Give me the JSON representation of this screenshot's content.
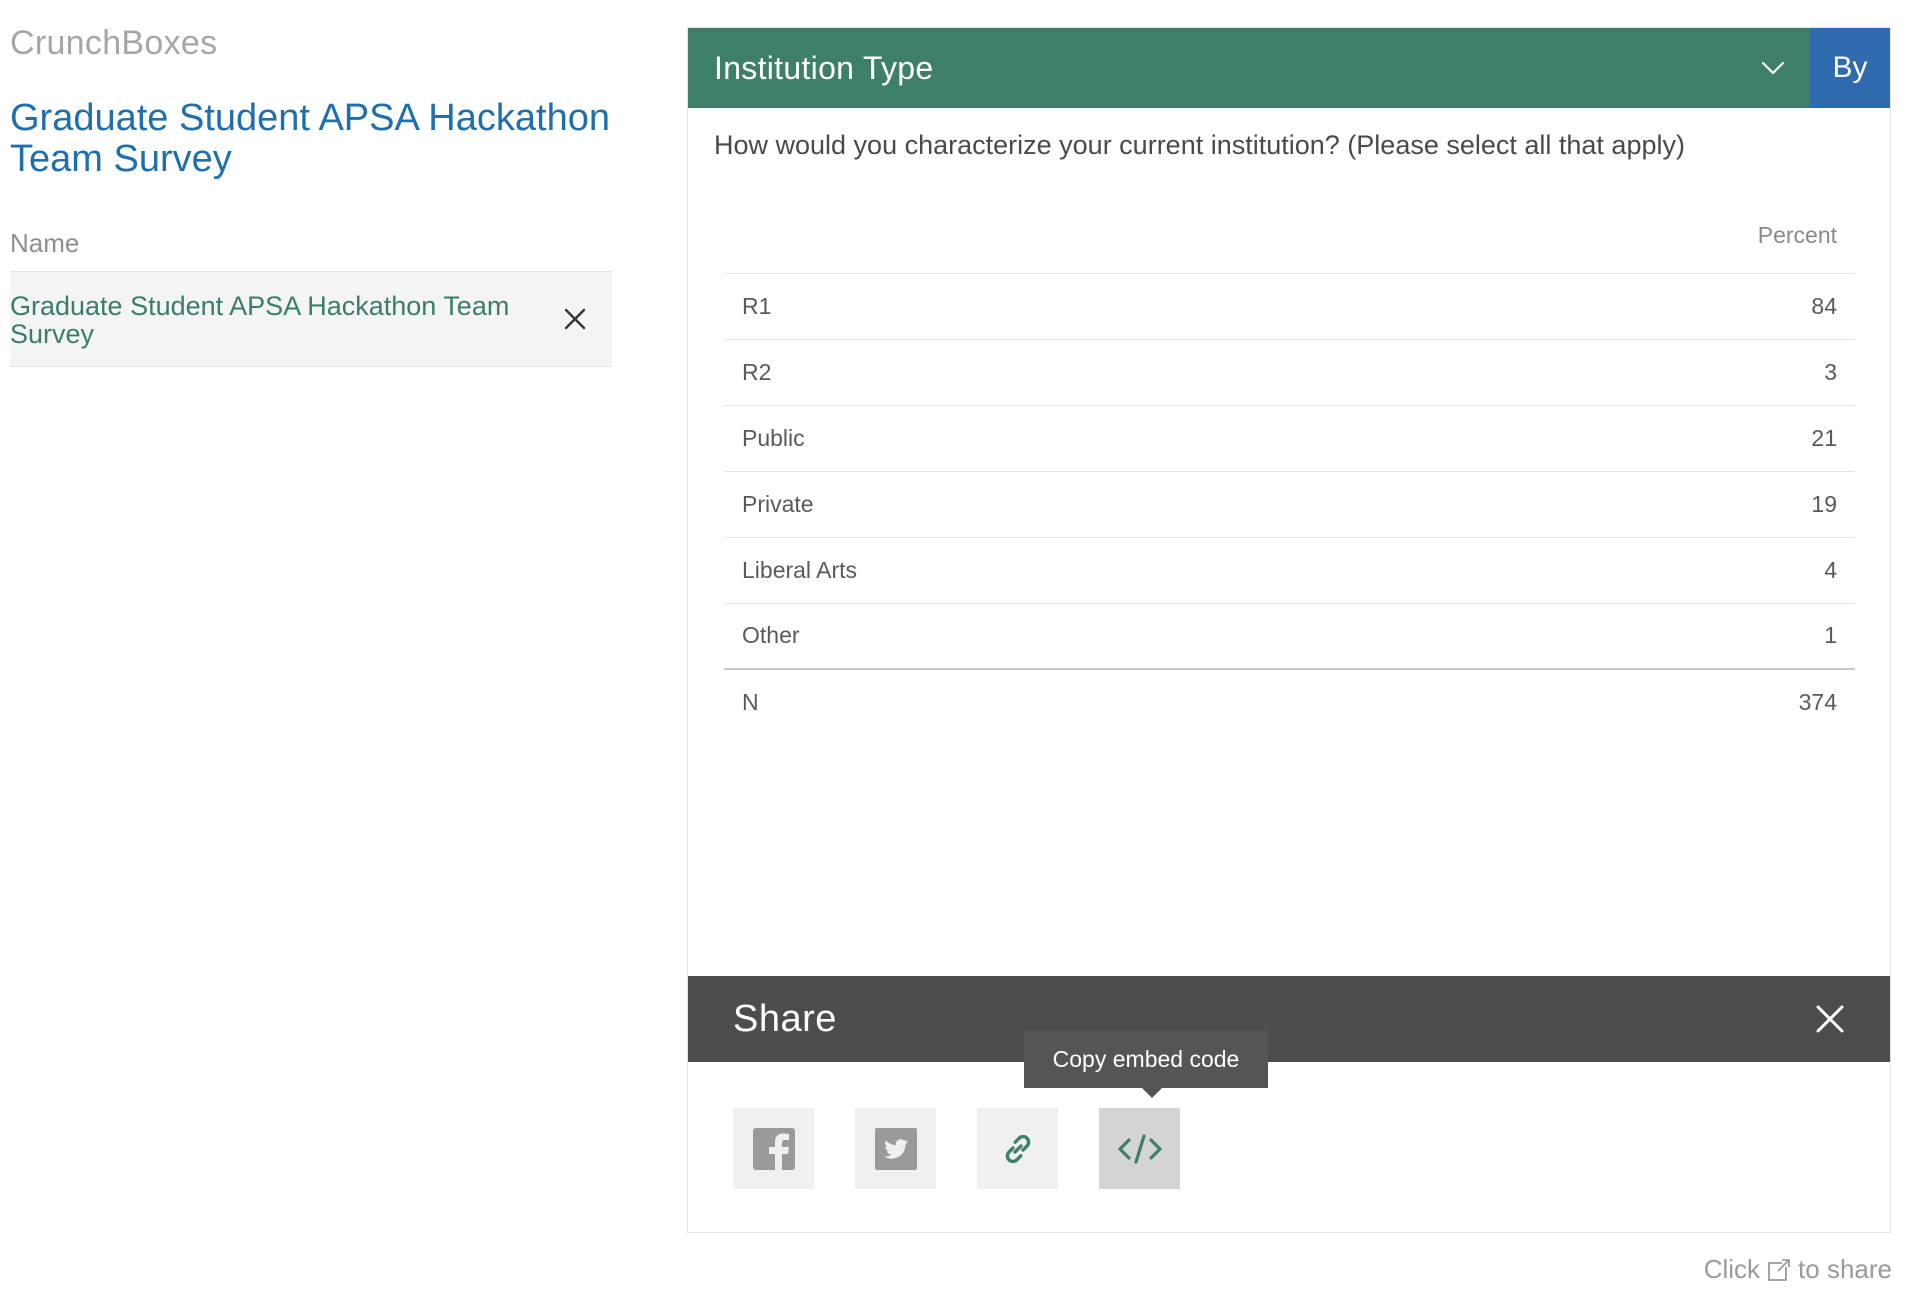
{
  "app": {
    "brand": "CrunchBoxes"
  },
  "sidebar": {
    "survey_title": "Graduate Student APSA Hackathon Team Survey",
    "field_label": "Name",
    "selected_item": "Graduate Student APSA Hackathon Team Survey"
  },
  "card": {
    "title": "Institution Type",
    "by_label": "By",
    "question": "How would you characterize your current institution? (Please select all that apply)",
    "table": {
      "column_header": "Percent",
      "rows": [
        {
          "label": "R1",
          "value": "84"
        },
        {
          "label": "R2",
          "value": "3"
        },
        {
          "label": "Public",
          "value": "21"
        },
        {
          "label": "Private",
          "value": "19"
        },
        {
          "label": "Liberal Arts",
          "value": "4"
        },
        {
          "label": "Other",
          "value": "1"
        }
      ],
      "n_label": "N",
      "n_value": "374"
    }
  },
  "share": {
    "title": "Share",
    "tooltip": "Copy embed code",
    "buttons": [
      "facebook-icon",
      "twitter-icon",
      "link-icon",
      "embed-code-icon"
    ]
  },
  "footer": {
    "hint_prefix": "Click",
    "hint_suffix": "to share"
  },
  "colors": {
    "header_green": "#3e8067",
    "by_blue": "#2f6aae",
    "title_blue": "#1f6fad",
    "item_green": "#3a7d6c",
    "share_bar": "#4d4d4d"
  }
}
